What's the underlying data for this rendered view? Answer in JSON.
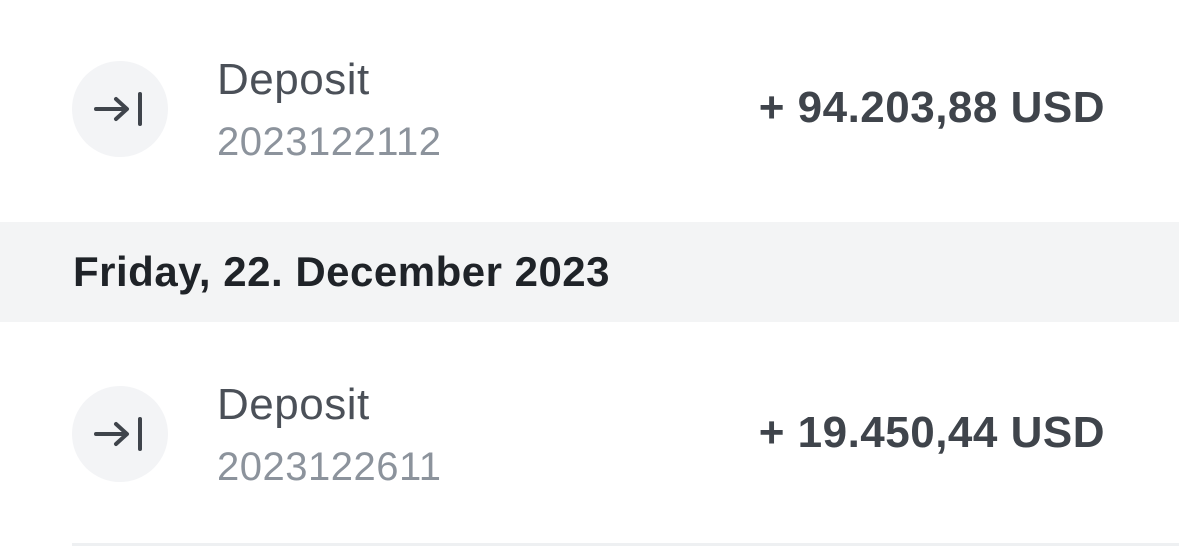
{
  "transactions": [
    {
      "type": "Deposit",
      "reference": "2023122112",
      "amount": "+ 94.203,88 USD",
      "icon": "arrow-right-to-bar-icon"
    },
    {
      "type": "Deposit",
      "reference": "2023122611",
      "amount": "+ 19.450,44 USD",
      "icon": "arrow-right-to-bar-icon"
    }
  ],
  "date_header": "Friday, 22. December 2023",
  "colors": {
    "icon_background": "#f3f4f6",
    "header_background": "#f3f4f5",
    "primary_text": "#1f2328",
    "secondary_text": "#8c939c"
  }
}
